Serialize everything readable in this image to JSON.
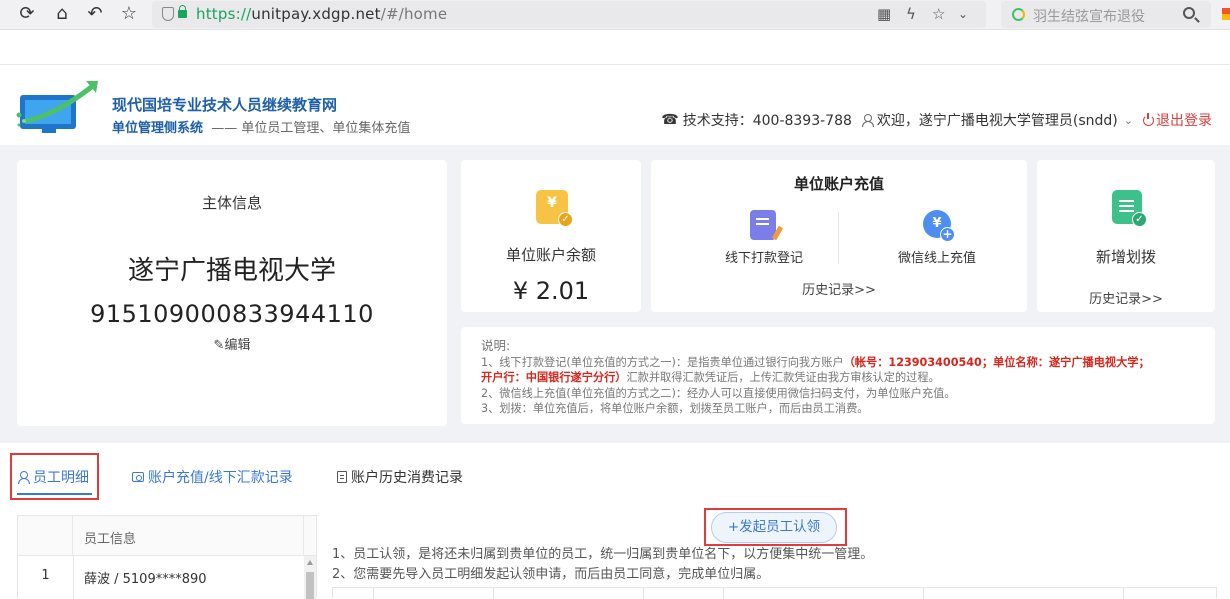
{
  "browser": {
    "url_scheme": "https://",
    "url_host": "unitpay.xdgp.net",
    "url_path": "/#/home",
    "search_placeholder": "羽生结弦宣布退役"
  },
  "header": {
    "site_title": "现代国培专业技术人员继续教育网",
    "subtitle_highlight": "单位管理侧系统",
    "subtitle_rest": "—— 单位员工管理、单位集体充值",
    "support": "技术支持：400-8393-788",
    "welcome": "欢迎，遂宁广播电视大学管理员(sndd)",
    "logout": "退出登录"
  },
  "main_info": {
    "label": "主体信息",
    "name": "遂宁广播电视大学",
    "code": "915109000833944110",
    "edit": "编辑"
  },
  "balance": {
    "label": "单位账户余额",
    "value": "¥ 2.01",
    "icon_glyph": "¥"
  },
  "recharge": {
    "title": "单位账户充值",
    "offline_label": "线下打款登记",
    "wechat_label": "微信线上充值",
    "wechat_glyph": "¥",
    "history": "历史记录>>"
  },
  "transfer": {
    "label": "新增划拨",
    "history": "历史记录>>"
  },
  "notes": {
    "title": "说明:",
    "line1_a": "1、线下打款登记(单位充值的方式之一)：是指贵单位通过银行向我方账户",
    "line1_red": "（帐号：123903400540；单位名称：遂宁广播电视大学；",
    "line1b_red": "开户行：中国银行遂宁分行）",
    "line1b_rest": "汇款并取得汇款凭证后，上传汇款凭证由我方审核认定的过程。",
    "line2": "2、微信线上充值(单位充值的方式之二)：经办人可以直接使用微信扫码支付，为单位账户充值。",
    "line3": "3、划拨：单位充值后，将单位账户余额，划拨至员工账户，而后由员工消费。"
  },
  "tabs": {
    "employees": "员工明细",
    "recharge_records": "账户充值/线下汇款记录",
    "consumption": "账户历史消费记录"
  },
  "employee_table": {
    "header": "员工信息",
    "rows": [
      {
        "index": "1",
        "value": "薛波 / 5109****890"
      }
    ]
  },
  "claim": {
    "button": "+发起员工认领",
    "note1": "1、员工认领，是将还未归属到贵单位的员工，统一归属到贵单位名下，以方便集中统一管理。",
    "note2": "2、您需要先导入员工明细发起认领申请，而后由员工同意，完成单位归属。"
  },
  "colors": {
    "brand_blue": "#1f5fa8",
    "accent_blue": "#3a78d8",
    "danger_red": "#e23b3b",
    "balance_icon": "#f6c344",
    "transfer_icon": "#3ec08a",
    "wechat_icon": "#4c8ff0",
    "offline_icon": "#7b7ee8"
  }
}
